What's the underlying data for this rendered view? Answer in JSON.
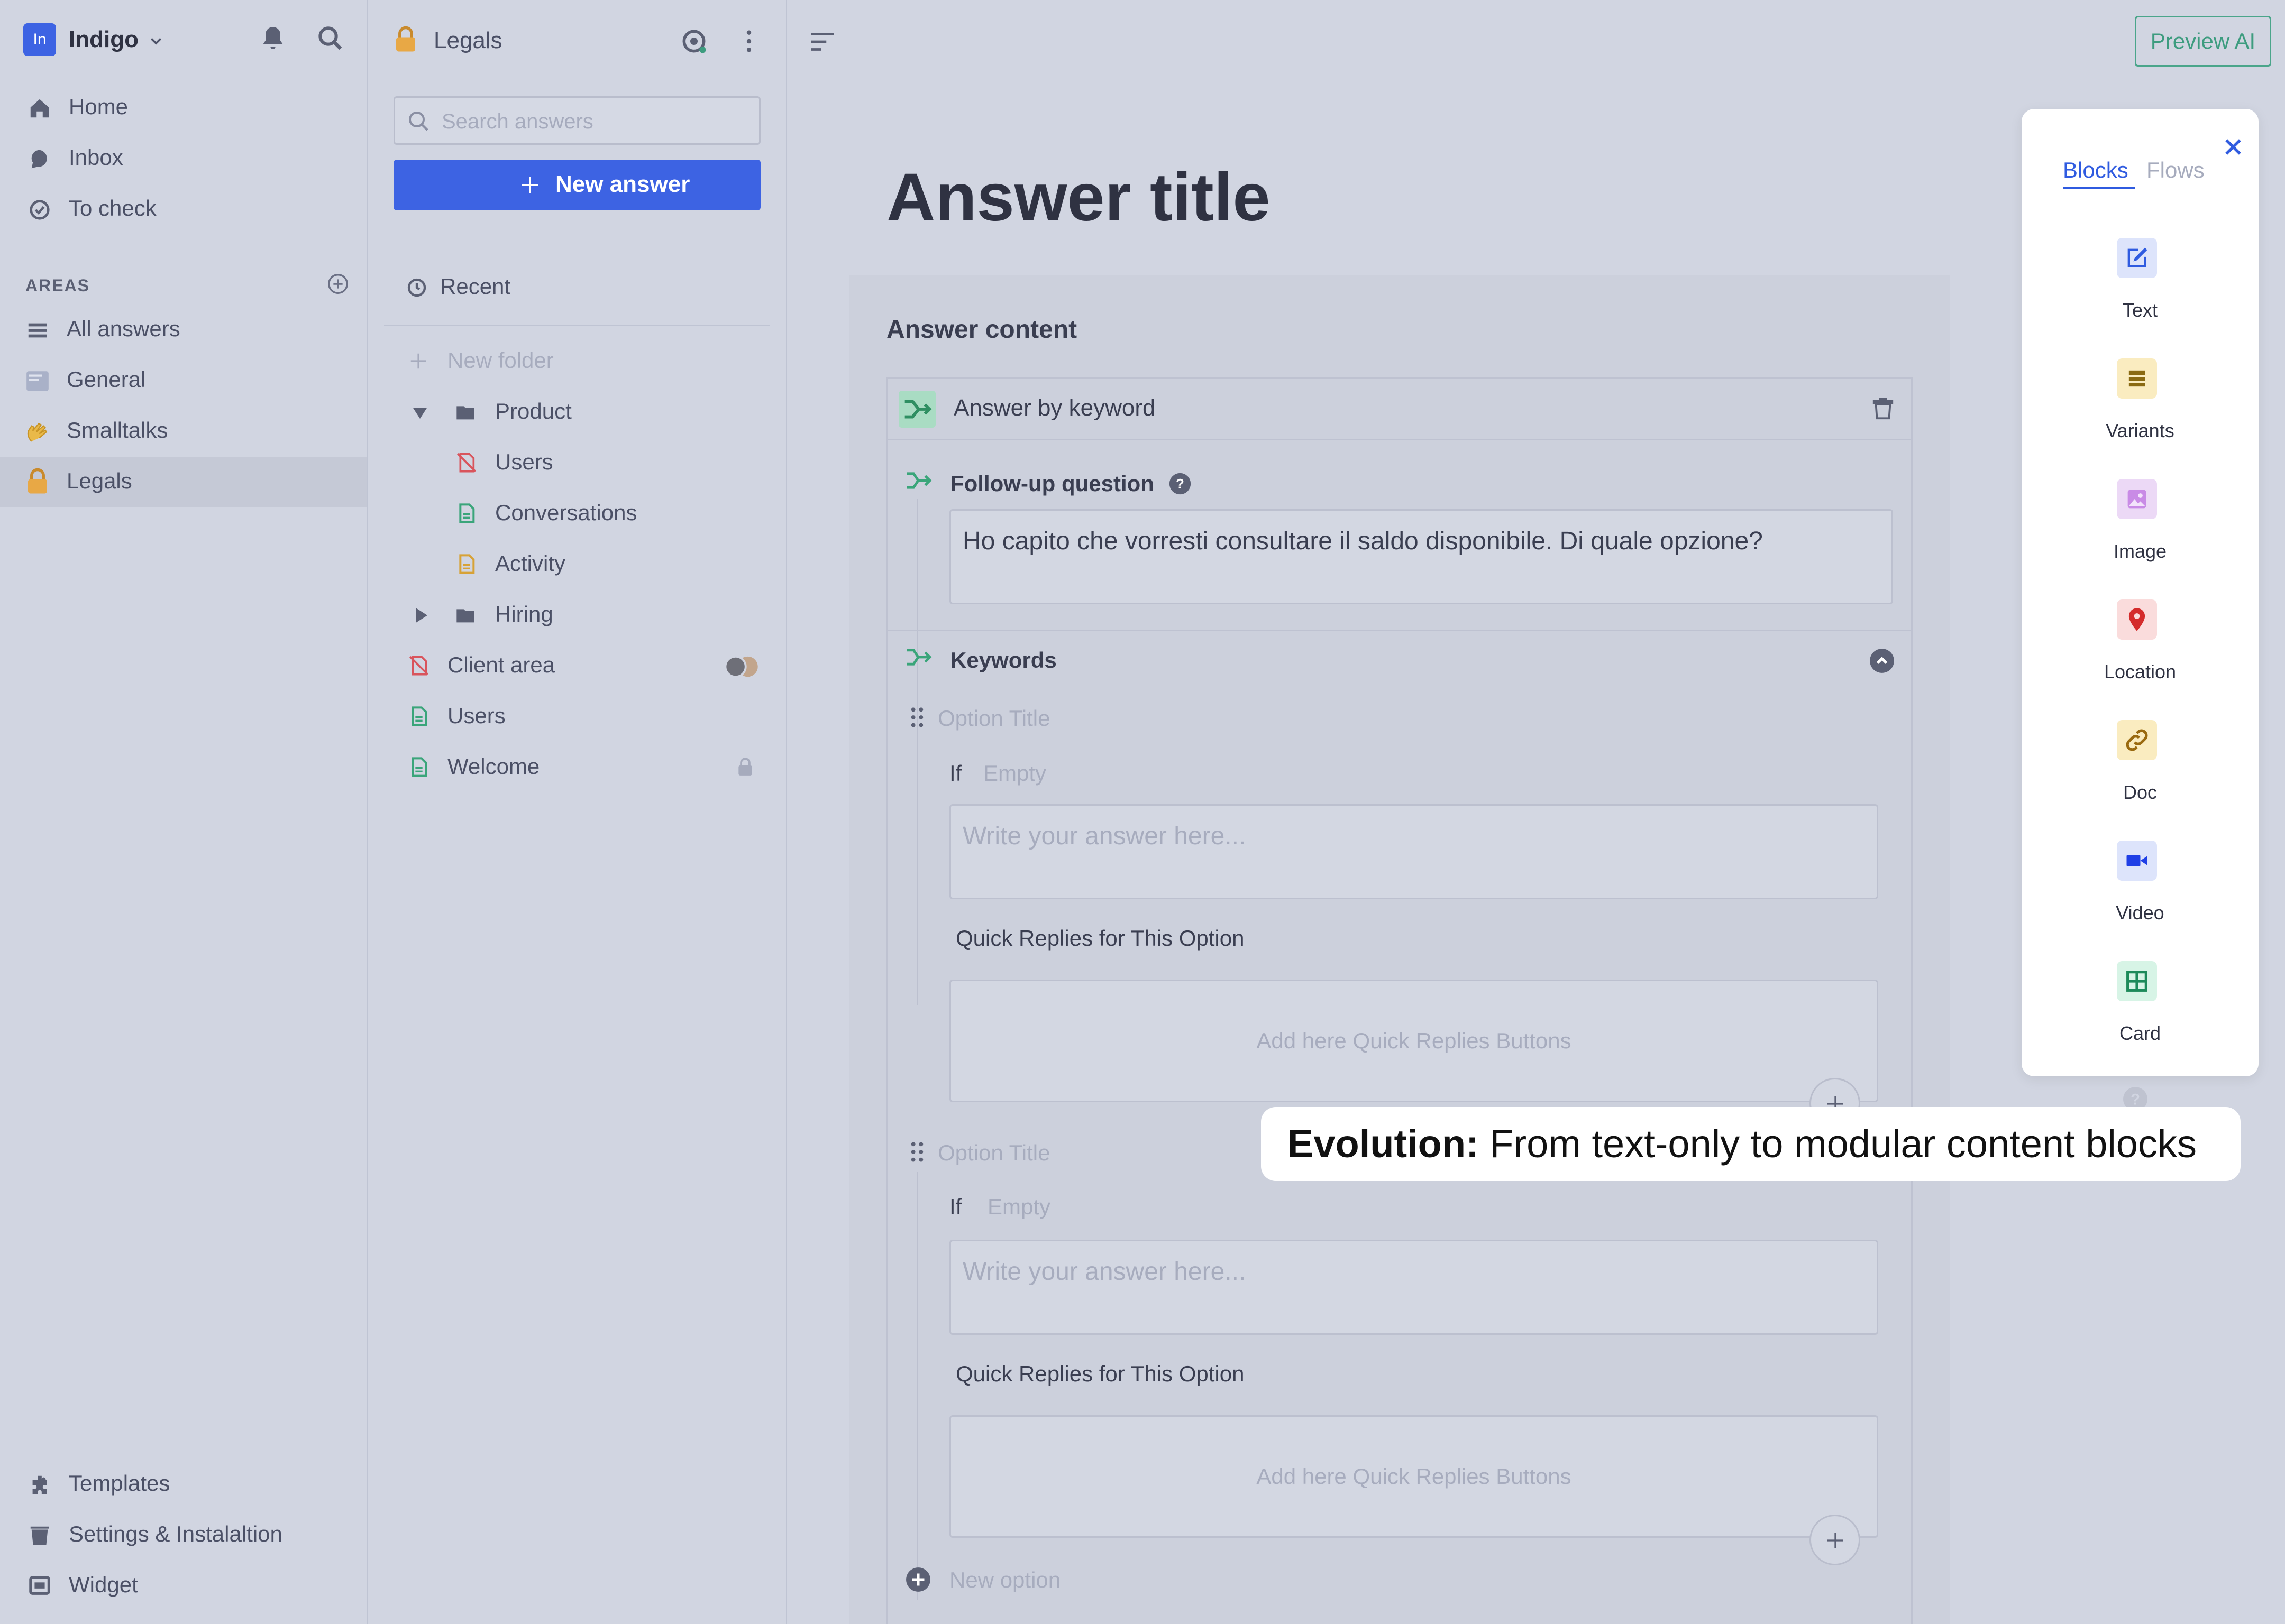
{
  "workspace": {
    "badge": "In",
    "name": "Indigo"
  },
  "nav": {
    "primary": [
      {
        "label": "Home",
        "icon": "home-icon"
      },
      {
        "label": "Inbox",
        "icon": "inbox-icon"
      },
      {
        "label": "To check",
        "icon": "check-circle-icon"
      }
    ],
    "areas_label": "AREAS",
    "areas": [
      {
        "label": "All answers",
        "icon": "list-icon"
      },
      {
        "label": "General",
        "icon": "general-icon"
      },
      {
        "label": "Smalltalks",
        "icon": "wave-hand-icon"
      },
      {
        "label": "Legals",
        "icon": "lock-icon"
      }
    ],
    "bottom": [
      {
        "label": "Templates",
        "icon": "puzzle-icon"
      },
      {
        "label": "Settings & Instalaltion",
        "icon": "settings-icon"
      },
      {
        "label": "Widget",
        "icon": "widget-icon"
      }
    ]
  },
  "list": {
    "title": "Legals",
    "search_placeholder": "Search answers",
    "new_answer_label": "New answer",
    "recent_label": "Recent",
    "new_folder_label": "New folder",
    "tree": {
      "product": "Product",
      "product_users": "Users",
      "conversations": "Conversations",
      "activity": "Activity",
      "hiring": "Hiring",
      "client_area": "Client area",
      "users": "Users",
      "welcome": "Welcome"
    }
  },
  "main": {
    "preview_label": "Preview AI",
    "answer_title": "Answer title",
    "content_heading": "Answer content",
    "block_title": "Answer by keyword",
    "follow_up_label": "Follow-up question",
    "follow_up_value": "Ho capito che vorresti consultare il saldo disponibile. Di quale opzione?",
    "keywords_label": "Keywords",
    "options": [
      {
        "title_placeholder": "Option Title",
        "if_label": "If",
        "if_value": "Empty",
        "answer_placeholder": "Write your answer here...",
        "qr_label": "Quick Replies for This Option",
        "qr_placeholder": "Add here Quick Replies Buttons"
      },
      {
        "title_placeholder": "Option Title",
        "if_label": "If",
        "if_value": "Empty",
        "answer_placeholder": "Write your answer here...",
        "qr_label": "Quick Replies for This Option",
        "qr_placeholder": "Add here Quick Replies Buttons"
      }
    ],
    "new_option_label": "New option"
  },
  "panel": {
    "tabs": [
      "Blocks",
      "Flows"
    ],
    "active_tab": "Blocks",
    "blocks": [
      {
        "label": "Text",
        "icon": "edit-icon",
        "bg": "#dde4fb",
        "fg": "#2f5be0"
      },
      {
        "label": "Variants",
        "icon": "variants-icon",
        "bg": "#faecc0",
        "fg": "#8a6a12"
      },
      {
        "label": "Image",
        "icon": "image-icon",
        "bg": "#ecd9f6",
        "fg": "#b06ad7"
      },
      {
        "label": "Location",
        "icon": "location-pin-icon",
        "bg": "#fadcdc",
        "fg": "#d42c2c"
      },
      {
        "label": "Doc",
        "icon": "link-icon",
        "bg": "#faecc0",
        "fg": "#9a6a10"
      },
      {
        "label": "Video",
        "icon": "video-icon",
        "bg": "#dde4fb",
        "fg": "#1f3fe6"
      },
      {
        "label": "Card",
        "icon": "card-icon",
        "bg": "#d7f4e6",
        "fg": "#1d8a5a"
      }
    ]
  },
  "callout": {
    "bold": "Evolution:",
    "text": " From text-only to modular content blocks"
  },
  "colors": {
    "primary": "#3d63e3",
    "accent_green": "#3d9c7f",
    "background": "#d1d5e1"
  }
}
